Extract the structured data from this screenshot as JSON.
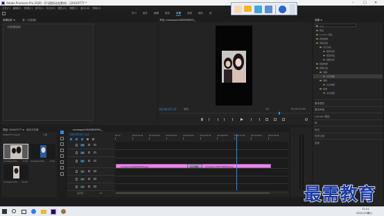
{
  "window": {
    "title": "Adobe Premiere Pro 2020 - D:\\视频\\动态素材\\...\\20410777 *",
    "controls": [
      "–",
      "□",
      "✕"
    ]
  },
  "menu": [
    "文件(F)",
    "编辑(E)",
    "剪辑(C)",
    "序列(S)",
    "标记(M)",
    "图形(G)",
    "视图(V)",
    "窗口(W)",
    "帮助(H)"
  ],
  "workspaces": [
    "学习",
    "组件",
    "编辑",
    "颜色",
    "效果",
    "音频",
    "图形",
    "库"
  ],
  "active_workspace_index": 4,
  "floating_toolbar": [
    "hand-icon",
    "comment-icon",
    "screenshot-icon",
    "share-icon",
    "info-icon",
    "collapse-icon"
  ],
  "source_panel": {
    "tabs": [
      "效果控件 ≡",
      "源：(无剪辑)"
    ],
    "label": "（无剪辑选择）"
  },
  "program_panel": {
    "title": "节目: mmexport1600858590__",
    "timecode_left": "00:00:07:23",
    "fit": "适合",
    "fraction": "1/2",
    "timecode_right": "00:00:10:00",
    "controls": [
      "marker-icon",
      "in-icon",
      "out-icon",
      "goto-in-icon",
      "step-back-icon",
      "play-icon",
      "step-forward-icon",
      "goto-out-icon",
      "lift-icon",
      "extract-icon",
      "export-frame-icon",
      "settings-icon"
    ]
  },
  "effects_panel": {
    "title": "效果 ≡",
    "search_placeholder": "搜索",
    "tree": [
      {
        "label": "预设",
        "level": 0
      },
      {
        "label": "Lumetri 预设",
        "level": 0
      },
      {
        "label": "音频效果",
        "level": 0
      },
      {
        "label": "音频过渡",
        "level": 0
      },
      {
        "label": "交叉淡化",
        "level": 1
      },
      {
        "label": "恒定功率",
        "level": 2
      },
      {
        "label": "恒定增益",
        "level": 2
      },
      {
        "label": "指数淡化",
        "level": 2
      },
      {
        "label": "视频效果",
        "level": 0
      },
      {
        "label": "视频过渡",
        "level": 0
      },
      {
        "label": "溶解",
        "level": 1
      },
      {
        "label": "交叉溶解",
        "level": 2
      },
      {
        "label": "擦除",
        "level": 1
      },
      {
        "label": "交叉擦除",
        "level": 2
      },
      {
        "label": "缩放",
        "level": 1
      },
      {
        "label": "交叉缩放",
        "level": 2
      }
    ],
    "selected_index": 11,
    "sections": [
      "基本图形",
      "基本声音",
      "Lumetri 颜色",
      "库",
      "标记",
      "历史记录",
      "信息"
    ]
  },
  "project_panel": {
    "tabs": [
      "项目: 20410777 ≡",
      "媒体浏览器"
    ],
    "path": "20410777.prproj",
    "count": "3 项",
    "items": [
      {
        "name": "mmexport16...",
        "duration": "5:00"
      },
      {
        "name": "mmexport16...",
        "duration": "5:00"
      },
      {
        "name": "mmexport16...",
        "duration": "10:00"
      }
    ]
  },
  "tools": [
    "selection-tool-icon",
    "track-select-icon",
    "ripple-edit-icon",
    "razor-icon",
    "slip-icon",
    "pen-icon",
    "hand-tool-icon",
    "type-tool-icon"
  ],
  "timeline": {
    "tab": "mmexport1600858590__",
    "timecode": "00:00:07:23",
    "ruler": [
      "00:00",
      "00:00:01:00",
      "00:00:02:00",
      "00:00:03:00",
      "00:00:04:00",
      "00:00:05:00",
      "00:00:06:00",
      "00:00:07:00",
      "00:00:08:00",
      "00:00:09:00"
    ],
    "tracks": [
      "V3",
      "V2",
      "V1",
      "A1",
      "A2",
      "A3"
    ],
    "master": "主声道",
    "master_value": "0.0",
    "clips": [
      {
        "label": "mmexport1600858590.jpg"
      },
      {
        "label": "mmexport1607785622.jpg"
      }
    ],
    "transition_label": "交叉溶解"
  },
  "taskbar": {
    "icons": [
      "start-icon",
      "search-icon",
      "taskview-icon",
      "edge-icon",
      "folder-icon",
      "premiere-icon",
      "chrome-icon"
    ],
    "time": "11:14",
    "date": "2021/1/3周六"
  },
  "watermark": "最需教育",
  "colors": {
    "accent": "#2d8ceb",
    "clip": "#e68ae6",
    "watermark": "#1b3aa5",
    "timecode": "#2d8ceb"
  }
}
